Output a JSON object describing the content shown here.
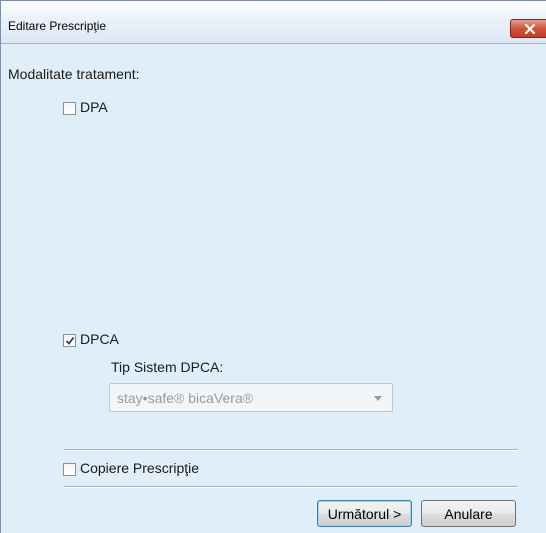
{
  "window": {
    "title": "Editare Prescripţie"
  },
  "treatment": {
    "heading": "Modalitate tratament:",
    "dpa": {
      "label": "DPA",
      "checked": false
    },
    "dpca": {
      "label": "DPCA",
      "checked": true
    },
    "system_type": {
      "label": "Tip Sistem DPCA:",
      "value": "stay•safe® bicaVera®"
    }
  },
  "copy_prescription": {
    "label": "Copiere Prescripţie",
    "checked": false
  },
  "buttons": {
    "next": "Următorul >",
    "cancel": "Anulare"
  }
}
